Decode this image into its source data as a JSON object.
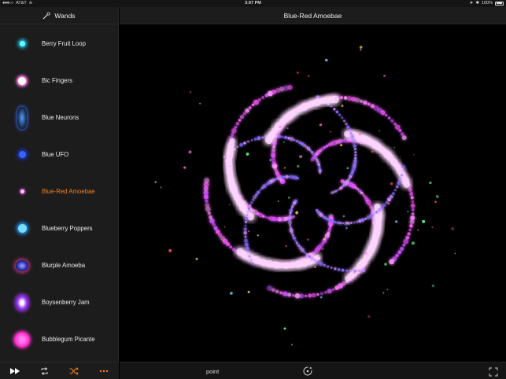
{
  "status": {
    "carrier": "AT&T",
    "time": "3:07 PM",
    "battery": "100%"
  },
  "sidebar": {
    "title": "Wands",
    "items": [
      {
        "label": "Berry Fruit Loop",
        "selected": false,
        "color": "#39d6ff"
      },
      {
        "label": "Bic Fingers",
        "selected": false,
        "color": "#ffffff"
      },
      {
        "label": "Blue Neurons",
        "selected": false,
        "color": "#3a6cff"
      },
      {
        "label": "Blue UFO",
        "selected": false,
        "color": "#2f4dff"
      },
      {
        "label": "Blue-Red Amoebae",
        "selected": true,
        "color": "#ff5fff"
      },
      {
        "label": "Blueberry Poppers",
        "selected": false,
        "color": "#3fbfff"
      },
      {
        "label": "Blurple Amoeba",
        "selected": false,
        "color": "#4a55ff"
      },
      {
        "label": "Boysenberry Jam",
        "selected": false,
        "color": "#b04aff"
      },
      {
        "label": "Bubblegum Picante",
        "selected": false,
        "color": "#ff33cc"
      }
    ]
  },
  "main": {
    "title": "Blue-Red Amoebae",
    "mode": "point"
  },
  "colors": {
    "accent": "#f07f1f",
    "selected_label": "#f07f1f",
    "glow_primary": "#ff66ff",
    "glow_secondary": "#7a5cff"
  },
  "icons": {
    "sidebar_header": "wand-icon",
    "footer": [
      "fast-forward-icon",
      "repeat-icon",
      "shuffle-icon",
      "more-icon"
    ],
    "main_footer": [
      "rotate-icon",
      "fullscreen-icon"
    ]
  }
}
